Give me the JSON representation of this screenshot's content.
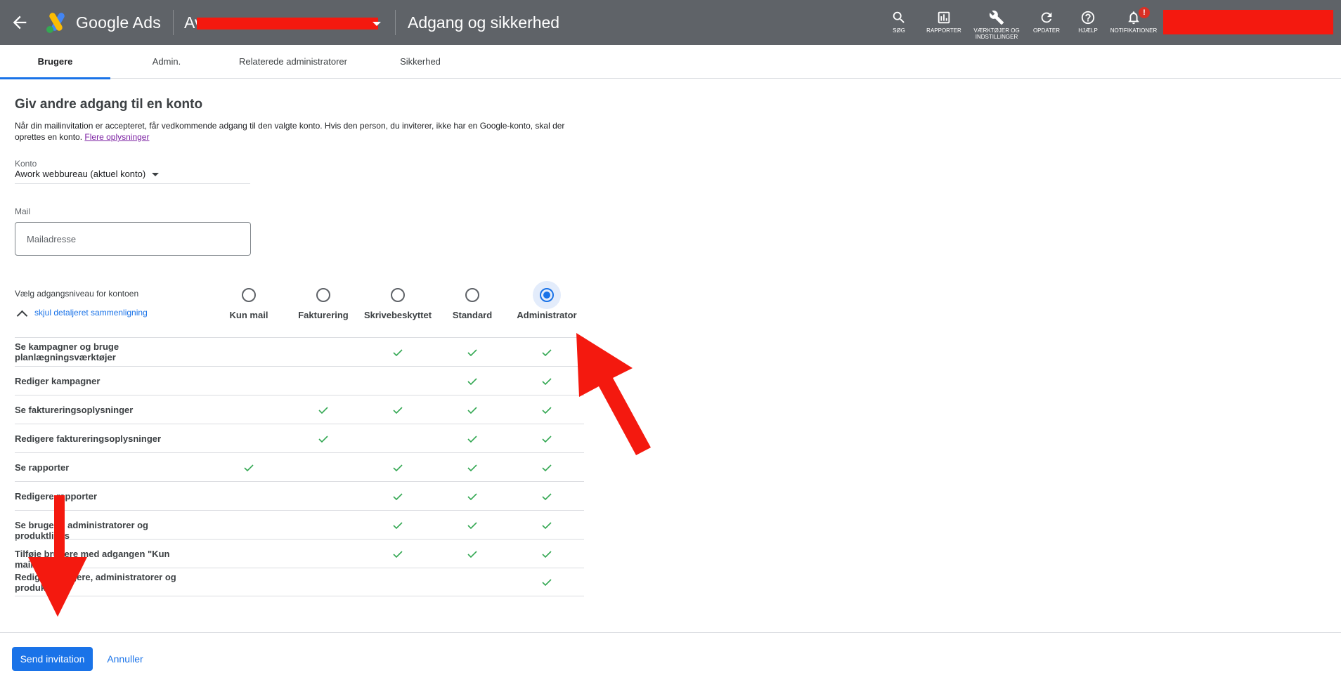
{
  "header": {
    "brand": "Google Ads",
    "account_prefix": "Av",
    "title": "Adgang og sikkerhed",
    "tools": [
      {
        "icon": "search-icon",
        "label": "SØG"
      },
      {
        "icon": "reports-icon",
        "label": "RAPPORTER"
      },
      {
        "icon": "wrench-icon",
        "label": "VÆRKTØJER OG INDSTILLINGER"
      },
      {
        "icon": "refresh-icon",
        "label": "OPDATER"
      },
      {
        "icon": "help-icon",
        "label": "HJÆLP"
      },
      {
        "icon": "bell-icon",
        "label": "NOTIFIKATIONER"
      }
    ],
    "notification_badge": "!"
  },
  "tabs": [
    {
      "label": "Brugere",
      "active": true
    },
    {
      "label": "Admin.",
      "active": false
    },
    {
      "label": "Relaterede administratorer",
      "active": false
    },
    {
      "label": "Sikkerhed",
      "active": false
    }
  ],
  "form": {
    "heading": "Giv andre adgang til en konto",
    "description": "Når din mailinvitation er accepteret, får vedkommende adgang til den valgte konto. Hvis den person, du inviterer, ikke har en Google-konto, skal der oprettes en konto.",
    "more_info_link": "Flere oplysninger",
    "account_label": "Konto",
    "account_value": "Awork webbureau (aktuel konto)",
    "mail_label": "Mail",
    "mail_placeholder": "Mailadresse",
    "mail_value": "",
    "access_label": "Vælg adgangsniveau for kontoen",
    "toggle_comparison": "skjul detaljeret sammenligning",
    "access_levels": [
      "Kun mail",
      "Fakturering",
      "Skrivebeskyttet",
      "Standard",
      "Administrator"
    ],
    "selected_level": "Administrator"
  },
  "permissions": [
    {
      "label": "Se kampagner og bruge planlægningsværktøjer",
      "checks": [
        false,
        false,
        true,
        true,
        true
      ]
    },
    {
      "label": "Rediger kampagner",
      "checks": [
        false,
        false,
        false,
        true,
        true
      ]
    },
    {
      "label": "Se faktureringsoplysninger",
      "checks": [
        false,
        true,
        true,
        true,
        true
      ]
    },
    {
      "label": "Redigere faktureringsoplysninger",
      "checks": [
        false,
        true,
        false,
        true,
        true
      ]
    },
    {
      "label": "Se rapporter",
      "checks": [
        true,
        false,
        true,
        true,
        true
      ]
    },
    {
      "label": "Redigere rapporter",
      "checks": [
        false,
        false,
        true,
        true,
        true
      ]
    },
    {
      "label": "Se brugere, administratorer og produktlinks",
      "checks": [
        false,
        false,
        true,
        true,
        true
      ]
    },
    {
      "label": "Tilføje brugere med adgangen \"Kun mail\"",
      "checks": [
        false,
        false,
        true,
        true,
        true
      ]
    },
    {
      "label": "Redigere brugere, administratorer og produktlinks",
      "checks": [
        false,
        false,
        false,
        false,
        true
      ]
    }
  ],
  "actions": {
    "send": "Send invitation",
    "cancel": "Annuller"
  },
  "colors": {
    "header_bg": "#5f6368",
    "accent": "#1a73e8",
    "check": "#34a853",
    "redaction": "#f4190f",
    "annotation_arrow": "#f4190f"
  }
}
